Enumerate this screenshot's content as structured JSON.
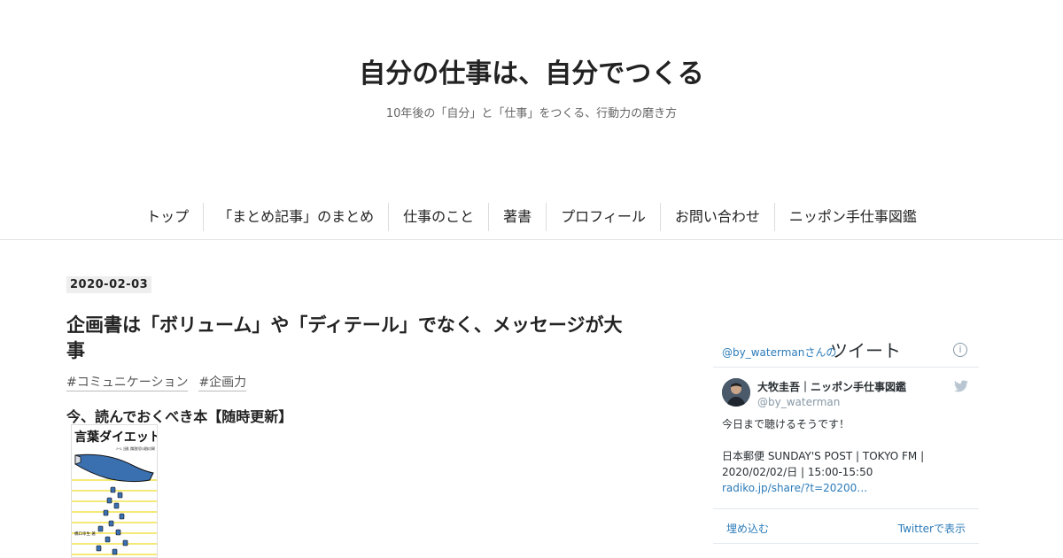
{
  "site": {
    "title": "自分の仕事は、自分でつくる",
    "description": "10年後の「自分」と「仕事」をつくる、行動力の磨き方"
  },
  "nav": [
    {
      "label": "トップ"
    },
    {
      "label": "「まとめ記事」のまとめ"
    },
    {
      "label": "仕事のこと"
    },
    {
      "label": "著書"
    },
    {
      "label": "プロフィール"
    },
    {
      "label": "お問い合わせ"
    },
    {
      "label": "ニッポン手仕事図鑑"
    }
  ],
  "entry": {
    "date": "2020-02-03",
    "title": "企画書は「ボリューム」や「ディテール」でなく、メッセージが大事",
    "tags": [
      "#コミュニケーション",
      "#企画力"
    ],
    "section_heading": "今、読んでおくべき本【随時更新】",
    "book": {
      "title": "言葉ダイエット",
      "subtitle": "メール、企画書、就職活動が変わる最強の文章術",
      "author": "橋口幸生 著"
    }
  },
  "twitter": {
    "header_handle": "@by_watermanさんの",
    "header_title": "ツイート",
    "info_icon": "i",
    "tweet": {
      "name": "大牧圭吾｜ニッポン手仕事図鑑",
      "handle": "@by_waterman",
      "text": "今日まで聴けるそうです！\n\n日本郵便 SUNDAY'S POST | TOKYO FM | 2020/02/02/日 | 15:00-15:50 ",
      "link": "radiko.jp/share/?t=20200…"
    },
    "embed_label": "埋め込む",
    "view_label": "Twitterで表示",
    "link_color": "#2b7bb9"
  }
}
